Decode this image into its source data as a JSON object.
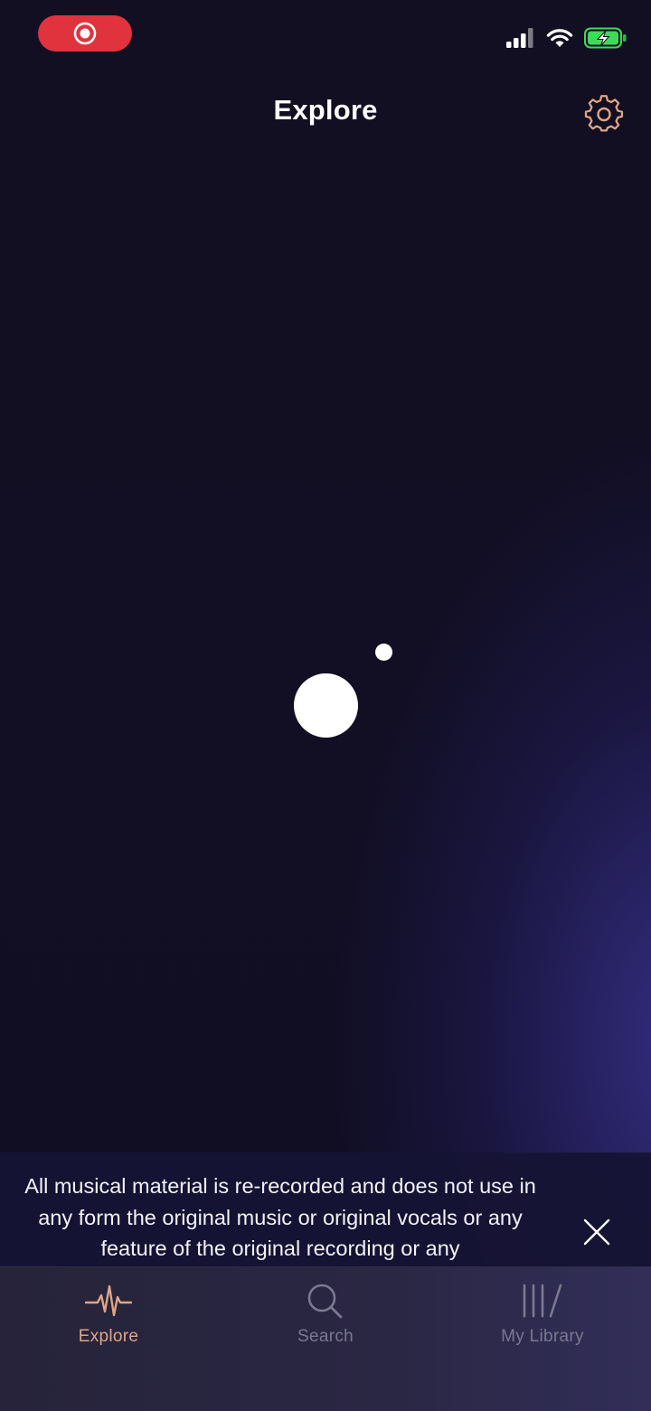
{
  "status_bar": {
    "recording_color": "#e0333e",
    "signal_icon": "cellular-signal-icon",
    "wifi_icon": "wifi-icon",
    "battery_icon": "battery-charging-icon",
    "battery_color": "#3ddc57"
  },
  "header": {
    "title": "Explore",
    "settings_icon": "gear-icon",
    "accent_color": "#e0a585"
  },
  "banner": {
    "text": "All musical material is re-recorded and does not use in any form the original music or original vocals or any feature of the original recording or any",
    "close_icon": "close-icon"
  },
  "tabbar": {
    "tabs": [
      {
        "label": "Explore",
        "icon": "waveform-icon",
        "active": true
      },
      {
        "label": "Search",
        "icon": "search-icon",
        "active": false
      },
      {
        "label": "My Library",
        "icon": "library-icon",
        "active": false
      }
    ]
  }
}
